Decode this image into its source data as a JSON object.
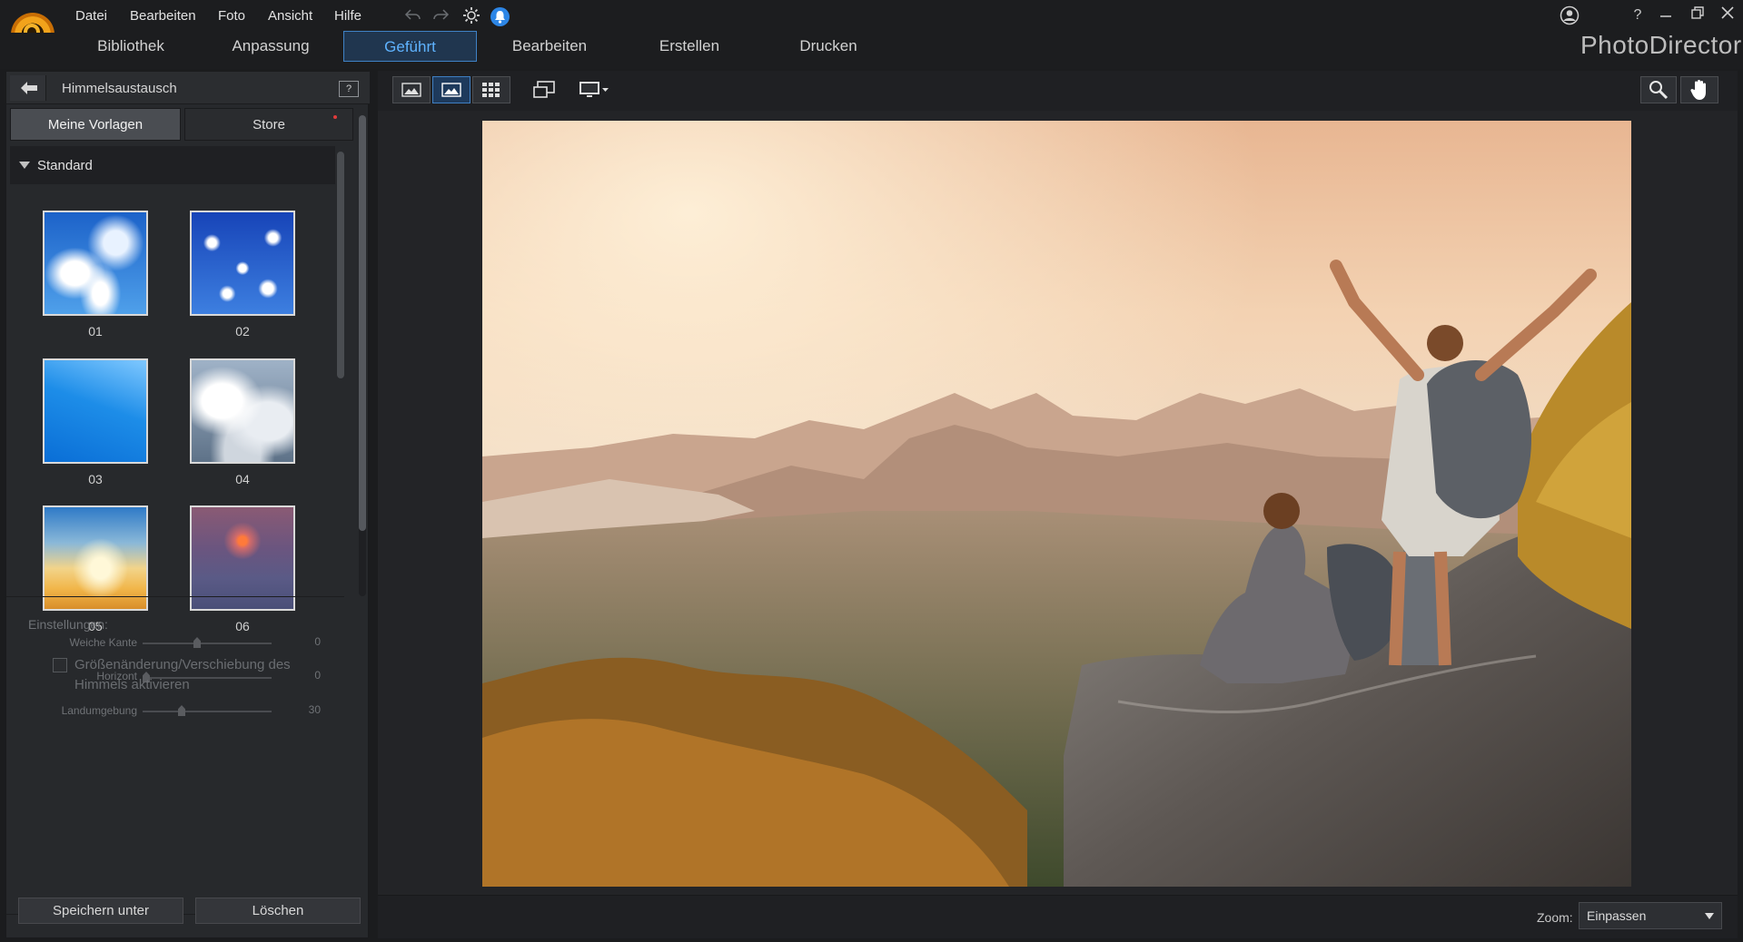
{
  "app": {
    "brand": "PhotoDirector"
  },
  "menu": {
    "items": [
      "Datei",
      "Bearbeiten",
      "Foto",
      "Ansicht",
      "Hilfe"
    ]
  },
  "modules": {
    "tabs": [
      "Bibliothek",
      "Anpassung",
      "Geführt",
      "Bearbeiten",
      "Erstellen",
      "Drucken"
    ],
    "active": "Geführt"
  },
  "panel": {
    "title": "Himmelsaustausch",
    "help": "?",
    "tabs": [
      "Meine Vorlagen",
      "Store"
    ],
    "category": "Standard",
    "thumbnails": [
      "01",
      "02",
      "03",
      "04",
      "05",
      "06"
    ],
    "settings_label": "Einstellungen:",
    "sliders": [
      {
        "label": "Weiche Kante",
        "value": "0",
        "level": 0.42
      },
      {
        "label": "Horizont",
        "value": "0",
        "level": 0.03
      },
      {
        "label": "Landumgebung",
        "value": "30",
        "level": 0.3
      }
    ],
    "resize_checkbox_label": "Größenänderung/Verschiebung des Himmels aktivieren",
    "save_button": "Speichern unter",
    "delete_button": "Löschen"
  },
  "status": {
    "zoom_label": "Zoom:",
    "zoom_value": "Einpassen"
  },
  "colors": {
    "accent": "#3f82c6",
    "active_tab_text": "#5fb3ff",
    "notification": "#2d86e6",
    "logo": "#f2a31b"
  },
  "icons": [
    "photodirector-logo-icon",
    "undo-icon",
    "redo-icon",
    "gear-icon",
    "bell-icon",
    "account-icon",
    "help-icon",
    "minimize-icon",
    "restore-icon",
    "close-icon",
    "back-arrow-icon",
    "help-panel-icon",
    "compare-view-icon",
    "single-view-icon",
    "grid-view-icon",
    "fullscreen-icon",
    "monitor-icon",
    "zoom-icon",
    "hand-pan-icon"
  ]
}
